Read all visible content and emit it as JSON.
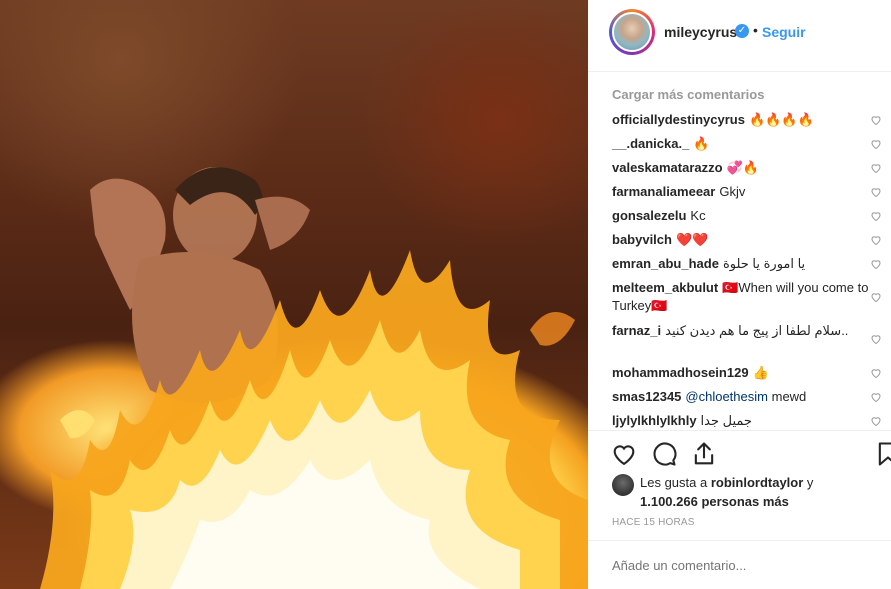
{
  "post": {
    "username": "mileycyrus",
    "verified_mark": "✓",
    "separator": "•",
    "follow_label": "Seguir"
  },
  "comments_section": {
    "load_more_label": "Cargar más comentarios",
    "comments": [
      {
        "user": "officiallydestinycyrus",
        "text": "🔥🔥🔥🔥"
      },
      {
        "user": "__.danicka._",
        "text": "🔥"
      },
      {
        "user": "valeskamatarazzo",
        "text": "💞🔥"
      },
      {
        "user": "farmanaliameear",
        "text": "Gkjv"
      },
      {
        "user": "gonsalezelu",
        "text": "Kc"
      },
      {
        "user": "babyvilch",
        "text": "❤️❤️"
      },
      {
        "user": "emran_abu_hade",
        "text": "يا امورة يا حلوة"
      },
      {
        "user": "melteem_akbulut",
        "text": "🇹🇷When will you come to Turkey🇹🇷"
      },
      {
        "user": "farnaz_i",
        "text": "سلام لطفا از پیج ما هم دیدن کنید.."
      },
      {
        "user": "mohammadhosein129",
        "text": "👍"
      },
      {
        "user": "smas12345",
        "mention": "@chloethesim",
        "text": "mewd"
      },
      {
        "user": "ljylylkhlylkhly",
        "text": "جمیل جدا"
      }
    ]
  },
  "likes": {
    "prefix": "Les gusta a",
    "first_user": "robinlordtaylor",
    "conjunction": "y",
    "count_text": "1.100.266 personas más"
  },
  "timestamp": "HACE 15 HORAS",
  "add_comment": {
    "placeholder": "Añade un comentario..."
  },
  "icons": [
    "heart-icon",
    "comment-icon",
    "share-icon",
    "save-icon",
    "verified-badge-icon"
  ],
  "colors": {
    "link_blue": "#3897f0",
    "text": "#262626",
    "muted": "#999999",
    "divider": "#efefef"
  }
}
